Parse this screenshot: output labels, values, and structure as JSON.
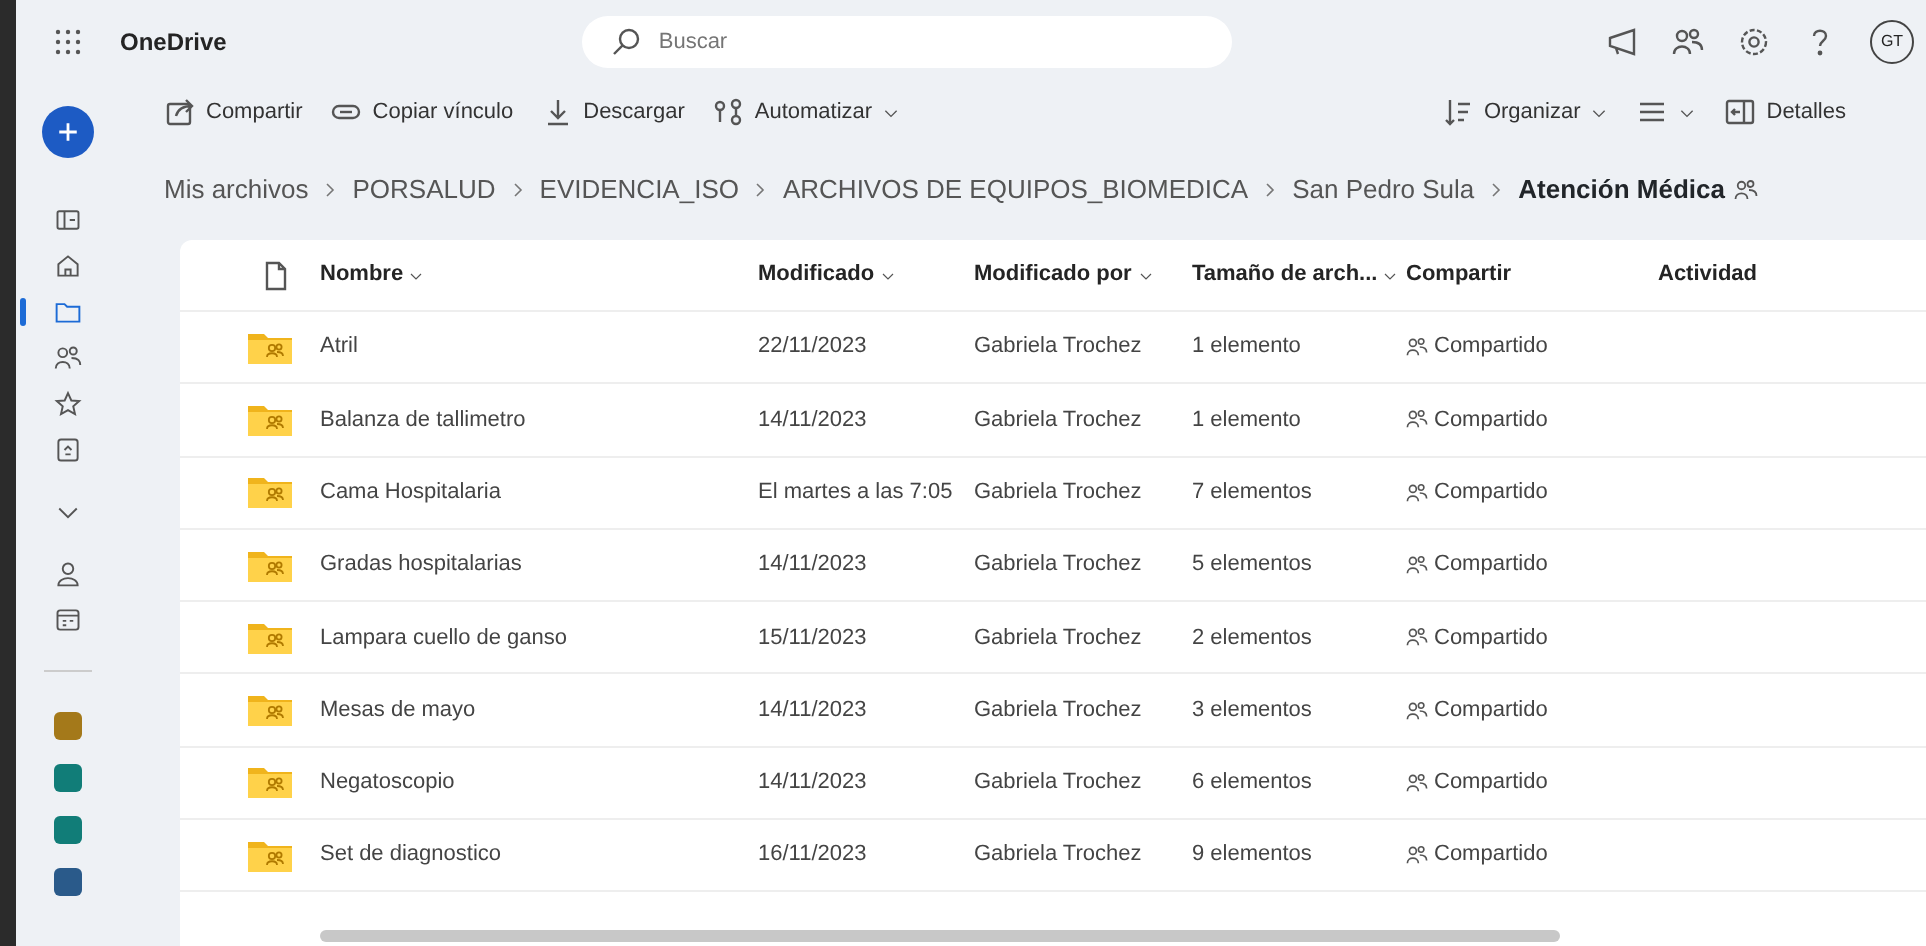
{
  "app": {
    "title": "OneDrive"
  },
  "search": {
    "placeholder": "Buscar"
  },
  "account": {
    "initials": "GT"
  },
  "toolbar": {
    "left": [
      {
        "label": "Compartir",
        "kind": "share"
      },
      {
        "label": "Copiar vínculo",
        "kind": "link"
      },
      {
        "label": "Descargar",
        "kind": "download"
      },
      {
        "label": "Automatizar",
        "kind": "automate"
      }
    ],
    "right": [
      {
        "label": "Organizar",
        "kind": "sort"
      },
      {
        "kind": "view"
      },
      {
        "label": "Detalles",
        "kind": "details"
      }
    ]
  },
  "sidebar": {
    "items": [
      {
        "kind": "panel",
        "selected": false
      },
      {
        "kind": "home",
        "selected": false
      },
      {
        "kind": "folder",
        "selected": true
      },
      {
        "kind": "people",
        "selected": false
      },
      {
        "kind": "star",
        "selected": false
      },
      {
        "kind": "bin",
        "selected": false
      },
      {
        "kind": "chevron",
        "selected": false
      },
      {
        "kind": "person",
        "selected": false
      },
      {
        "kind": "calendar",
        "selected": false
      }
    ],
    "libraries": [
      {
        "color": "#a4791a"
      },
      {
        "color": "#117d78"
      },
      {
        "color": "#117d78"
      },
      {
        "color": "#2a5a8a"
      }
    ]
  },
  "breadcrumb": [
    "Mis archivos",
    "PORSALUD",
    "EVIDENCIA_ISO",
    "ARCHIVOS DE EQUIPOS_BIOMEDICA",
    "San Pedro Sula",
    "Atención Médica"
  ],
  "table": {
    "columns": [
      {
        "label": "Nombre",
        "sortable": true
      },
      {
        "label": "Modificado",
        "sortable": true
      },
      {
        "label": "Modificado por",
        "sortable": true
      },
      {
        "label": "Tamaño de arch...",
        "sortable": true
      },
      {
        "label": "Compartir",
        "sortable": false
      },
      {
        "label": "Actividad",
        "sortable": false
      }
    ],
    "rows": [
      {
        "name": "Atril",
        "modified": "22/11/2023",
        "by": "Gabriela Trochez",
        "size": "1 elemento",
        "sharing": "Compartido"
      },
      {
        "name": "Balanza de tallimetro",
        "modified": "14/11/2023",
        "by": "Gabriela Trochez",
        "size": "1 elemento",
        "sharing": "Compartido"
      },
      {
        "name": "Cama Hospitalaria",
        "modified": "El martes a las 7:05",
        "by": "Gabriela Trochez",
        "size": "7 elementos",
        "sharing": "Compartido"
      },
      {
        "name": "Gradas hospitalarias",
        "modified": "14/11/2023",
        "by": "Gabriela Trochez",
        "size": "5 elementos",
        "sharing": "Compartido"
      },
      {
        "name": "Lampara cuello de ganso",
        "modified": "15/11/2023",
        "by": "Gabriela Trochez",
        "size": "2 elementos",
        "sharing": "Compartido"
      },
      {
        "name": "Mesas de mayo",
        "modified": "14/11/2023",
        "by": "Gabriela Trochez",
        "size": "3 elementos",
        "sharing": "Compartido"
      },
      {
        "name": "Negatoscopio",
        "modified": "14/11/2023",
        "by": "Gabriela Trochez",
        "size": "6 elementos",
        "sharing": "Compartido"
      },
      {
        "name": "Set de diagnostico",
        "modified": "16/11/2023",
        "by": "Gabriela Trochez",
        "size": "9 elementos",
        "sharing": "Compartido"
      }
    ]
  }
}
